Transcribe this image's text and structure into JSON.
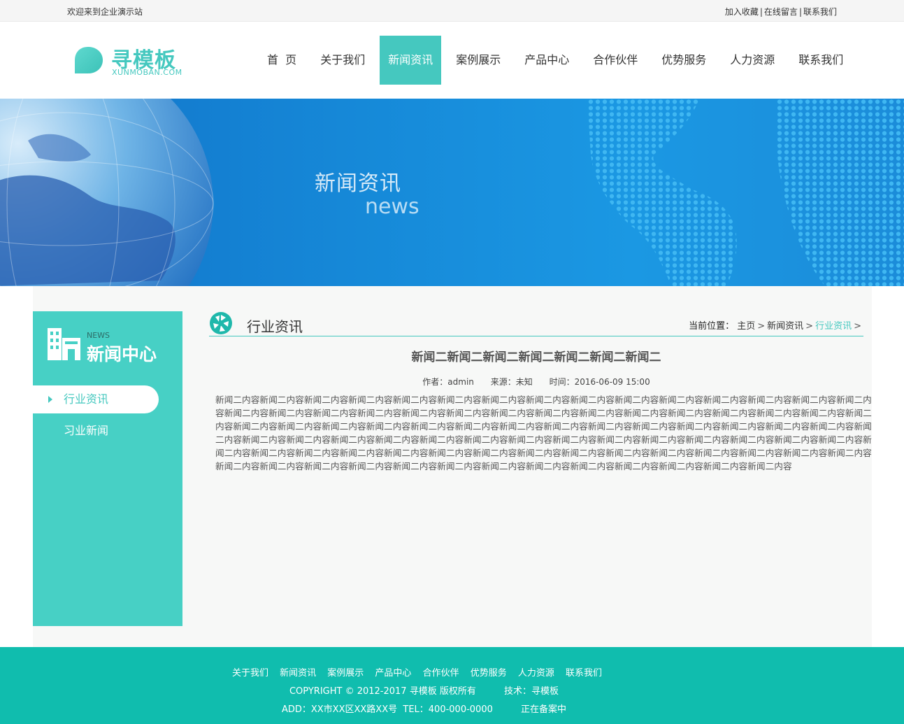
{
  "topbar": {
    "welcome": "欢迎来到企业演示站",
    "links": [
      "加入收藏",
      "在线留言",
      "联系我们"
    ]
  },
  "logo": {
    "name": "寻模板",
    "sub": "XUNMOBAN.COM"
  },
  "colors": {
    "accent": "#45c8bf",
    "footer": "#10bdae",
    "banner": "#1689d8"
  },
  "nav": [
    {
      "label": "首  页",
      "active": false
    },
    {
      "label": "关于我们",
      "active": false
    },
    {
      "label": "新闻资讯",
      "active": true
    },
    {
      "label": "案例展示",
      "active": false
    },
    {
      "label": "产品中心",
      "active": false
    },
    {
      "label": "合作伙伴",
      "active": false
    },
    {
      "label": "优势服务",
      "active": false
    },
    {
      "label": "人力资源",
      "active": false
    },
    {
      "label": "联系我们",
      "active": false
    }
  ],
  "banner": {
    "title": "新闻资讯",
    "subtitle": "news"
  },
  "sidebar": {
    "en": "NEWS",
    "title": "新闻中心",
    "items": [
      {
        "label": "行业资讯",
        "active": true
      },
      {
        "label": "习业新闻",
        "active": false
      }
    ]
  },
  "content": {
    "section_title": "行业资讯",
    "breadcrumb": {
      "label": "当前位置：",
      "items": [
        "主页",
        "新闻资讯",
        "行业资讯"
      ]
    },
    "article": {
      "title": "新闻二新闻二新闻二新闻二新闻二新闻二新闻二",
      "author": "作者：admin",
      "source": "来源：未知",
      "time": "时间：2016-06-09 15:00",
      "body": "新闻二内容新闻二内容新闻二内容新闻二内容新闻二内容新闻二内容新闻二内容新闻二内容新闻二内容新闻二内容新闻二内容新闻二内容新闻二内容新闻二内容新闻二内容新闻二内容新闻二内容新闻二内容新闻二内容新闻二内容新闻二内容新闻二内容新闻二内容新闻二内容新闻二内容新闻二内容新闻二内容新闻二内容新闻二内容新闻二内容新闻二内容新闻二内容新闻二内容新闻二内容新闻二内容新闻二内容新闻二内容新闻二内容新闻二内容新闻二内容新闻二内容新闻二内容新闻二内容新闻二内容新闻二内容新闻二内容新闻二内容新闻二内容新闻二内容新闻二内容新闻二内容新闻二内容新闻二内容新闻二内容新闻二内容新闻二内容新闻二内容新闻二内容新闻二内容新闻二内容新闻二内容新闻二内容新闻二内容新闻二内容新闻二内容新闻二内容新闻二内容新闻二内容新闻二内容新闻二内容新闻二内容新闻二内容新闻二内容新闻二内容新闻二内容新闻二内容新闻二内容新闻二内容新闻二内容新闻二内容新闻二内容新闻二内容新闻二内容新闻二内容新闻二内容新闻二内容新闻二内容"
    }
  },
  "footer": {
    "links": [
      "关于我们",
      "新闻资讯",
      "案例展示",
      "产品中心",
      "合作伙伴",
      "优势服务",
      "人力资源",
      "联系我们"
    ],
    "copyright": "COPYRIGHT © 2012-2017 寻模板 版权所有",
    "tech": "技术：寻模板",
    "address": "ADD：XX市XX区XX路XX号  TEL：400-000-0000",
    "record": "正在备案中"
  }
}
